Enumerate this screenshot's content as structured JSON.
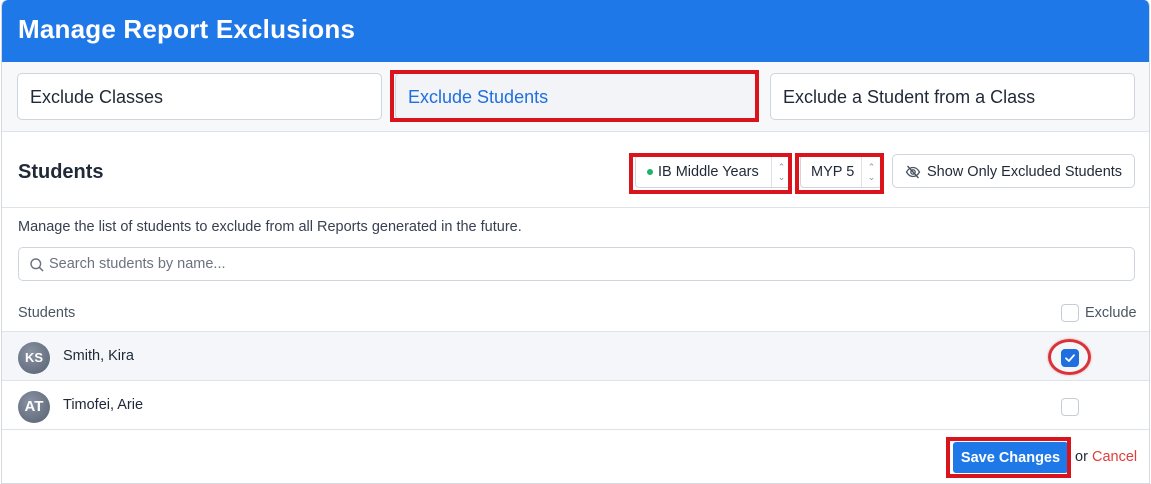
{
  "header": {
    "title": "Manage Report Exclusions"
  },
  "tabs": [
    {
      "label": "Exclude Classes",
      "active": false
    },
    {
      "label": "Exclude Students",
      "active": true
    },
    {
      "label": "Exclude a Student from a Class",
      "active": false
    }
  ],
  "section": {
    "title": "Students",
    "program_select": {
      "value": "IB Middle Years",
      "status_color": "#1fb36a"
    },
    "grade_select": {
      "value": "MYP 5"
    },
    "toggle_label": "Show Only Excluded Students"
  },
  "description": "Manage the list of students to exclude from all Reports generated in the future.",
  "search": {
    "placeholder": "Search students by name...",
    "value": ""
  },
  "table": {
    "col_students": "Students",
    "col_exclude": "Exclude",
    "rows": [
      {
        "initials": "KS",
        "name": "Smith, Kira",
        "excluded": true
      },
      {
        "initials": "AT",
        "name": "Timofei, Arie",
        "excluded": false
      }
    ]
  },
  "footer": {
    "save_label": "Save Changes",
    "or_text": "or",
    "cancel_label": "Cancel"
  },
  "colors": {
    "primary": "#1f78e8",
    "highlight": "#d9141c",
    "cancel": "#e23b3b"
  },
  "icons": [
    "eye-slash-icon",
    "search-icon",
    "checkmark-icon",
    "select-arrows-icon"
  ]
}
